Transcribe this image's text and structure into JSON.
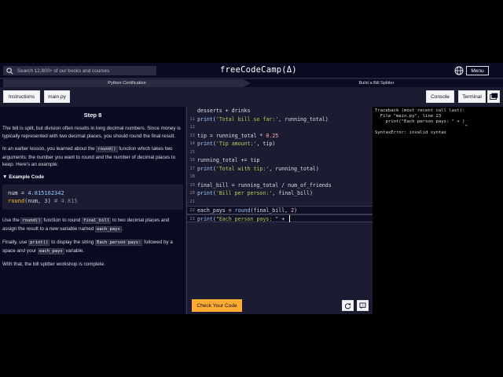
{
  "nav": {
    "search_placeholder": "Search 12,800+ of our books and courses",
    "logo": "freeCodeCamp(Δ)",
    "menu_label": "Menu"
  },
  "breadcrumb": {
    "items": [
      "Python Certification",
      "Build a Bill Splitter"
    ]
  },
  "tabs": {
    "instructions": "Instructions",
    "file": "main.py",
    "console": "Console",
    "terminal": "Terminal"
  },
  "instructions": {
    "title": "Step 8",
    "p1": "The bill is split, but division often results in long decimal numbers. Since money is typically represented with two decimal places, you should round the final result.",
    "p2_a": "In an earlier lesson, you learned about the ",
    "p2_code": "round()",
    "p2_b": " function which takes two arguments: the number you want to round and the number of decimal places to keep. Here's an example:",
    "example_summary": "▼ Example Code",
    "example": {
      "line1_var": "num",
      "line1_eq": " = ",
      "line1_num": "4.815162342",
      "line2_fn": "round",
      "line2_args_a": "(num, ",
      "line2_num": "3",
      "line2_args_b": ") ",
      "line2_comment": "# 4.815"
    },
    "p3_a": "Use the ",
    "p3_code1": "round()",
    "p3_b": " function to round ",
    "p3_code2": "final_bill",
    "p3_c": " to two decimal places and assign the result to a new variable named ",
    "p3_code3": "each_pays",
    "p3_d": ".",
    "p4_a": "Finally, use ",
    "p4_code1": "print()",
    "p4_b": " to display the string ",
    "p4_code2": "Each person pays:",
    "p4_c": " followed by a space and your ",
    "p4_code3": "each_pays",
    "p4_d": " variable.",
    "p5": "With that, the bill splitter workshop is complete."
  },
  "editor": {
    "lines": [
      {
        "n": "",
        "a": "desserts + drinks"
      },
      {
        "n": "11",
        "fn": "print",
        "a": "(",
        "s": "'Total bill so far:'",
        "b": ", running_total)"
      },
      {
        "n": "12",
        "a": ""
      },
      {
        "n": "13",
        "a": "tip = running_total * ",
        "num": "0.25"
      },
      {
        "n": "14",
        "fn": "print",
        "a": "(",
        "s": "'Tip amount:'",
        "b": ", tip)"
      },
      {
        "n": "15",
        "a": ""
      },
      {
        "n": "16",
        "a": "running_total += tip"
      },
      {
        "n": "17",
        "fn": "print",
        "a": "(",
        "s": "'Total with tip:'",
        "b": ", running_total)"
      },
      {
        "n": "18",
        "a": ""
      },
      {
        "n": "19",
        "a": "final_bill = running_total / num_of_friends"
      },
      {
        "n": "20",
        "fn": "print",
        "a": "(",
        "s": "'Bill per person:'",
        "b": ", final_bill)"
      },
      {
        "n": "21",
        "a": ""
      },
      {
        "n": "22",
        "a": "each_pays = ",
        "fn2": "round",
        "a2": "(final_bill, ",
        "num": "2",
        "b": ")"
      },
      {
        "n": "23",
        "fn": "print",
        "a": "(",
        "s": "\"Each person pays: \"",
        "b": " + "
      }
    ],
    "check_label": "Check Your Code"
  },
  "console": {
    "output": "Traceback (most recent call last):\n  File \"main.py\", line 23\n    print(\"Each person pays: \" + )\n                                  ^\nSyntaxError: invalid syntax"
  },
  "colors": {
    "accent": "#feac32",
    "panel_dark": "#0a0a23",
    "panel": "#1b1b32"
  }
}
